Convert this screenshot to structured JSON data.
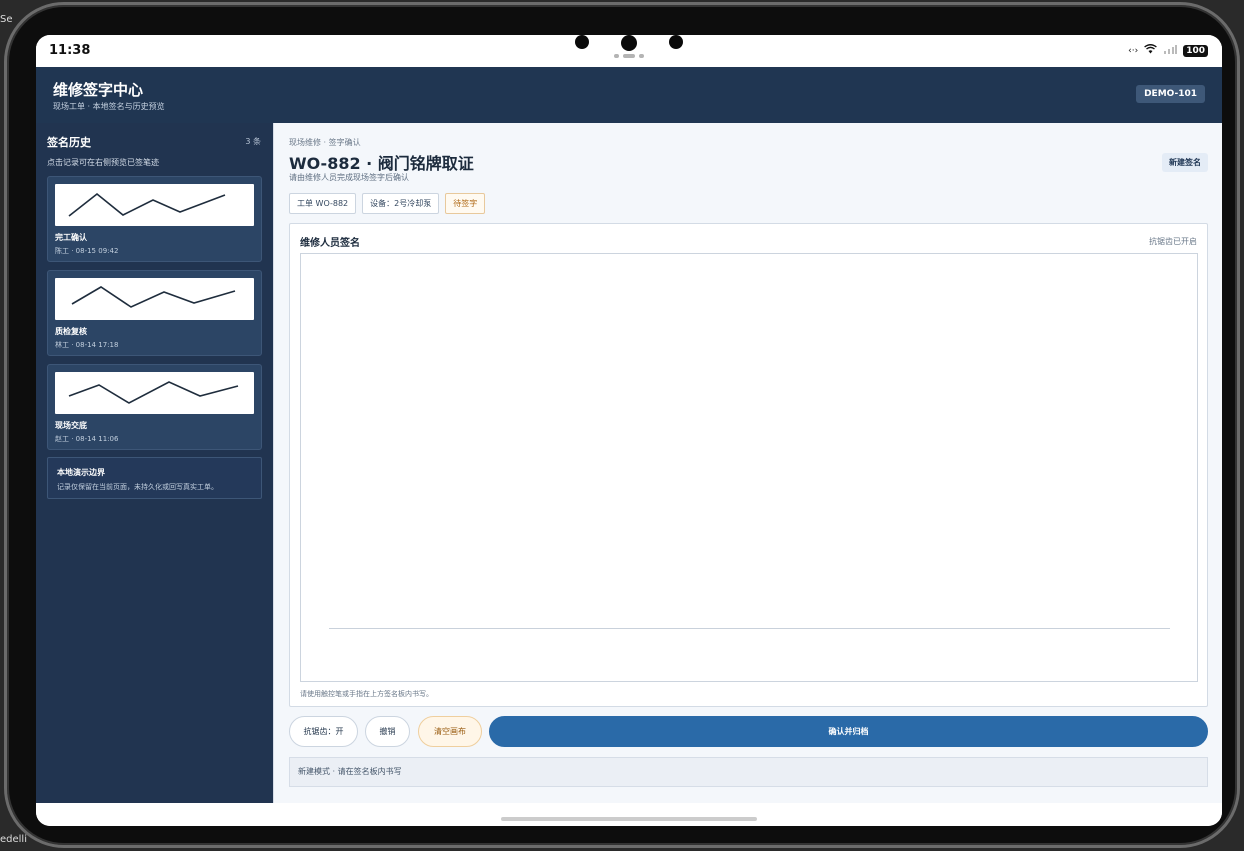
{
  "statusbar": {
    "time": "11:38",
    "battery": "100"
  },
  "app": {
    "title": "维修签字中心",
    "subtitle": "现场工单 · 本地签名与历史预览",
    "badge": "DEMO-101"
  },
  "sidebar": {
    "heading": "签名历史",
    "count": "3 条",
    "hint": "点击记录可在右侧预览已签笔迹",
    "items": [
      {
        "title": "完工确认",
        "meta": "陈工 · 08-15 09:42"
      },
      {
        "title": "质检复核",
        "meta": "林工 · 08-14 17:18"
      },
      {
        "title": "现场交底",
        "meta": "赵工 · 08-14 11:06"
      }
    ],
    "note": {
      "title": "本地演示边界",
      "desc": "记录仅保留在当前页面，未持久化或回写真实工单。"
    }
  },
  "main": {
    "breadcrumb": "现场维修 · 签字确认",
    "title": "WO-882 · 阀门铭牌取证",
    "subtitle": "请由维修人员完成现场签字后确认",
    "new_label": "新建签名",
    "chips": [
      "工单 WO-882",
      "设备：2号冷却泵",
      "待签字"
    ],
    "panel": {
      "title": "维修人员签名",
      "aa_status": "抗锯齿已开启",
      "help": "请使用触控笔或手指在上方签名板内书写。"
    },
    "actions": {
      "aa_toggle": "抗锯齿：开",
      "undo": "撤销",
      "clear": "清空画布",
      "confirm": "确认并归档"
    },
    "statusline": "新建模式 · 请在签名板内书写"
  }
}
